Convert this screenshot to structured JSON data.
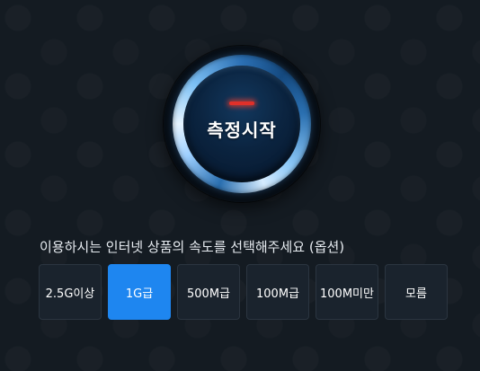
{
  "start_button": {
    "label": "측정시작",
    "indicator_color": "#e0302a",
    "ring_color": "#7cc0f5"
  },
  "speed_selector": {
    "question": "이용하시는 인터넷 상품의 속도를 선택해주세요 (옵션)",
    "selected_index": 1,
    "selected_color": "#1e86f0",
    "options": [
      {
        "label": "2.5G이상"
      },
      {
        "label": "1G급"
      },
      {
        "label": "500M급"
      },
      {
        "label": "100M급"
      },
      {
        "label": "100M미만"
      },
      {
        "label": "모름"
      }
    ]
  }
}
